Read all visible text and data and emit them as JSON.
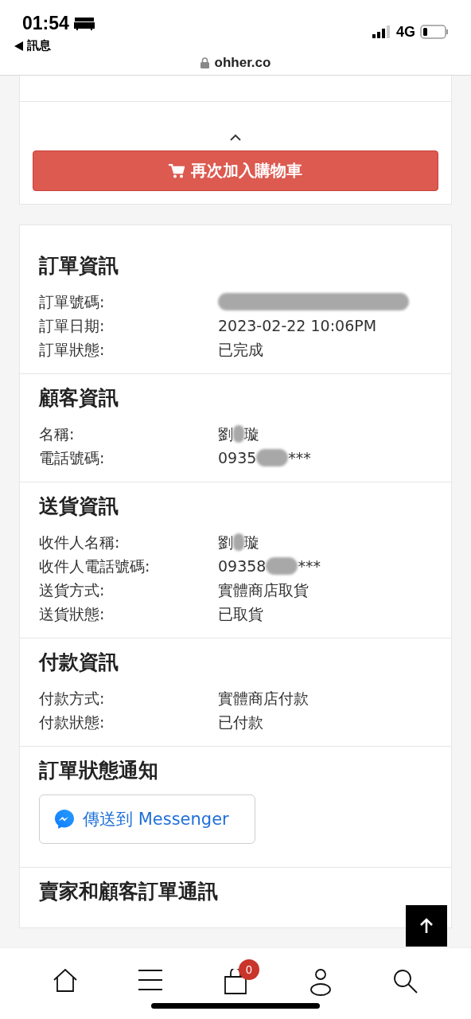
{
  "status_bar": {
    "time": "01:54",
    "back_label": "訊息",
    "network": "4G"
  },
  "address_bar": {
    "url": "ohher.co"
  },
  "reorder_button": {
    "label": "再次加入購物車"
  },
  "sections": [
    {
      "title": "訂單資訊",
      "kind": "details",
      "rows": [
        {
          "label": "訂單號碼:",
          "kind": "redacted"
        },
        {
          "label": "訂單日期:",
          "kind": "text",
          "value": "2023-02-22 10:06PM"
        },
        {
          "label": "訂單狀態:",
          "kind": "text",
          "value": "已完成"
        }
      ]
    },
    {
      "title": "顧客資訊",
      "kind": "details",
      "rows": [
        {
          "label": "名稱:",
          "kind": "masked",
          "parts": [
            "劉",
            "璇"
          ]
        },
        {
          "label": "電話號碼:",
          "kind": "masked",
          "parts": [
            "0935",
            "***"
          ]
        }
      ]
    },
    {
      "title": "送貨資訊",
      "kind": "details",
      "rows": [
        {
          "label": "收件人名稱:",
          "kind": "masked",
          "parts": [
            "劉",
            "璇"
          ]
        },
        {
          "label": "收件人電話號碼:",
          "kind": "masked",
          "parts": [
            "09358",
            "***"
          ]
        },
        {
          "label": "送貨方式:",
          "kind": "text",
          "value": "實體商店取貨"
        },
        {
          "label": "送貨狀態:",
          "kind": "text",
          "value": "已取貨"
        }
      ]
    },
    {
      "title": "付款資訊",
      "kind": "details",
      "rows": [
        {
          "label": "付款方式:",
          "kind": "text",
          "value": "實體商店付款"
        },
        {
          "label": "付款狀態:",
          "kind": "text",
          "value": "已付款"
        }
      ]
    },
    {
      "title": "訂單狀態通知",
      "kind": "notify",
      "button": {
        "label": "傳送到 Messenger"
      }
    },
    {
      "title": "賣家和顧客訂單通訊",
      "kind": "plain"
    }
  ],
  "bottom_nav": {
    "cart_count": "0"
  }
}
